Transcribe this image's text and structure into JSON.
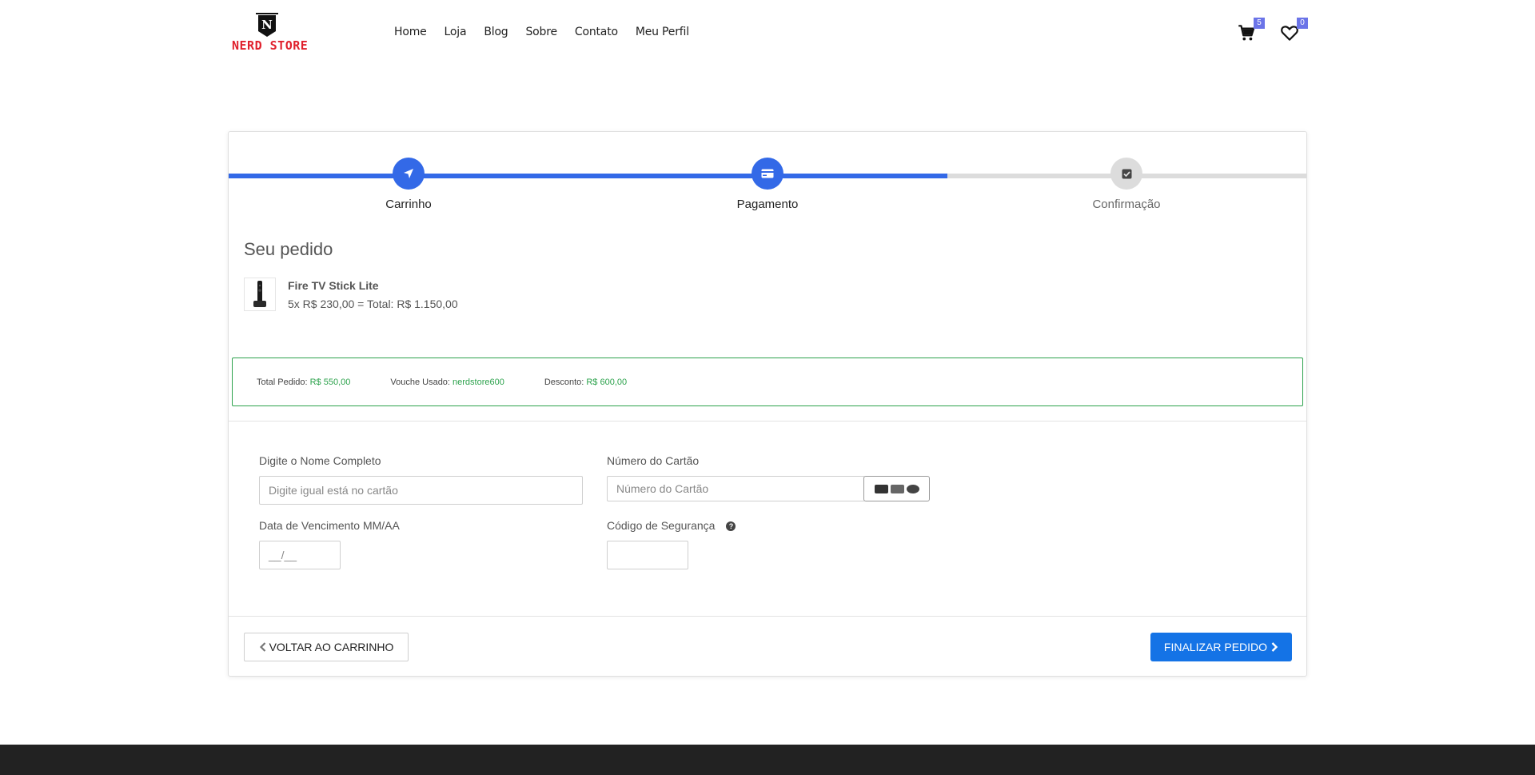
{
  "brand": {
    "name": "NERD STORE",
    "badge_letter": "N",
    "color": "#e0202c"
  },
  "nav": [
    "Home",
    "Loja",
    "Blog",
    "Sobre",
    "Contato",
    "Meu Perfil"
  ],
  "header_icons": {
    "cart": {
      "icon": "cart-icon",
      "count": "5"
    },
    "wishlist": {
      "icon": "heart-icon",
      "count": "0"
    }
  },
  "steps": [
    {
      "label": "Carrinho",
      "icon": "location-arrow-icon",
      "state": "done"
    },
    {
      "label": "Pagamento",
      "icon": "credit-card-icon",
      "state": "active"
    },
    {
      "label": "Confirmação",
      "icon": "check-square-icon",
      "state": "pending"
    }
  ],
  "progress_fraction": 0.667,
  "order": {
    "title": "Seu pedido",
    "product_name": "Fire TV Stick Lite",
    "product_line": "5x R$ 230,00 = Total: R$ 1.150,00"
  },
  "summary": {
    "total_label": "Total Pedido:",
    "total_value": "R$ 550,00",
    "voucher_label": "Vouche Usado:",
    "voucher_value": "nerdstore600",
    "discount_label": "Desconto:",
    "discount_value": "R$ 600,00"
  },
  "form": {
    "name_label": "Digite o Nome Completo",
    "name_placeholder": "Digite igual está no cartão",
    "card_label": "Número do Cartão",
    "card_placeholder": "Número do Cartão",
    "expiry_label": "Data de Vencimento MM/AA",
    "expiry_placeholder": "__/__",
    "cvv_label": "Código de Segurança",
    "cvv_help": "?"
  },
  "actions": {
    "back_label": "VOLTAR AO CARRINHO",
    "finish_label": "FINALIZAR PEDIDO"
  },
  "colors": {
    "accent": "#3369e7",
    "button": "#1473e6",
    "success": "#2ca24c",
    "badge": "#6b74e8",
    "footer": "#222222"
  }
}
